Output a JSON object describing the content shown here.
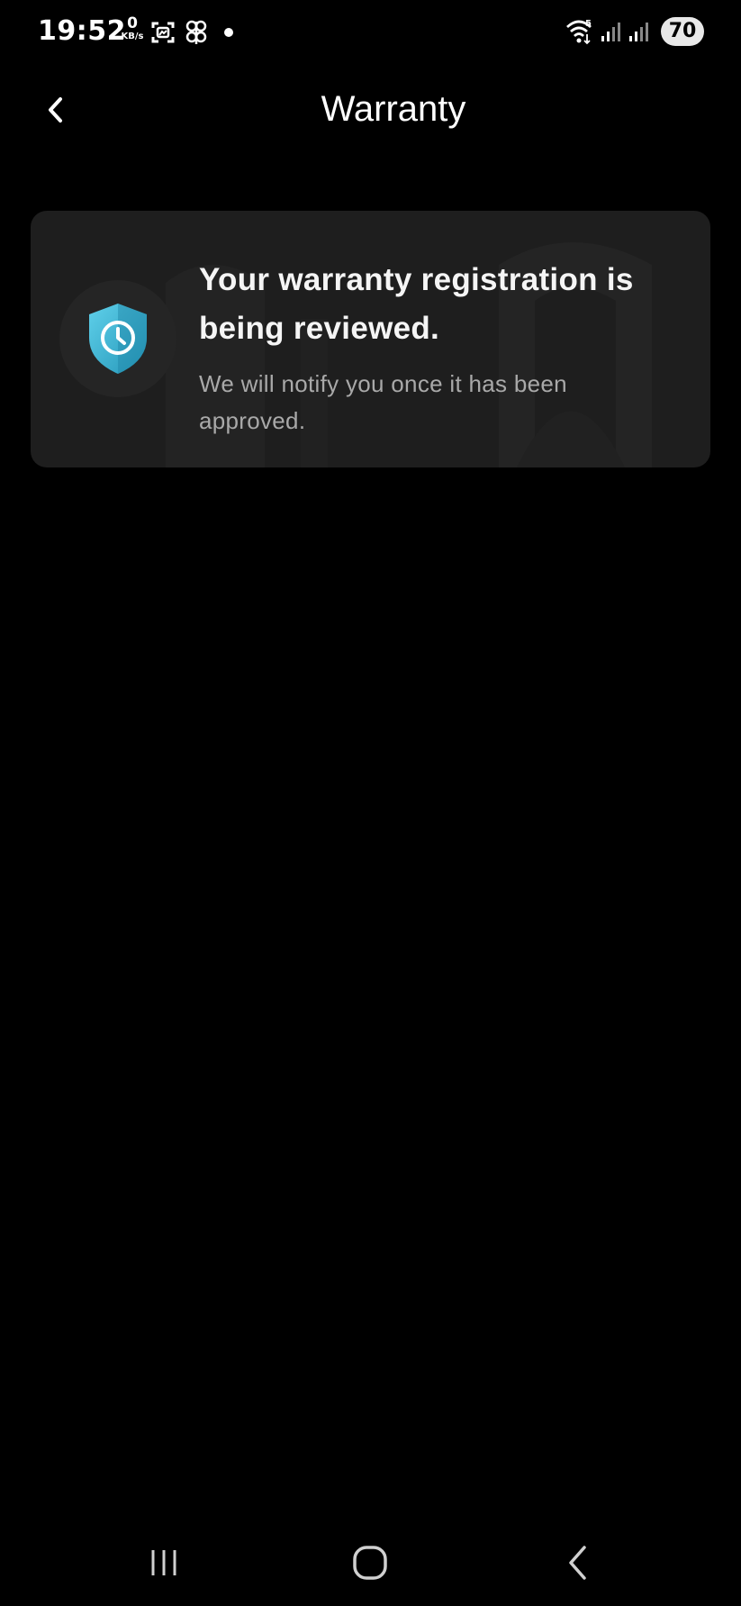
{
  "status_bar": {
    "time": "19:52",
    "data_rate_value": "0",
    "data_rate_unit": "KB/s",
    "battery": "70",
    "icons": [
      "screenshot-icon",
      "butterfly-icon",
      "notification-dot",
      "wifi-icon",
      "signal-icon",
      "signal-icon"
    ]
  },
  "header": {
    "title": "Warranty",
    "back_icon": "chevron-left-icon"
  },
  "card": {
    "icon": "shield-clock-icon",
    "title": "Your warranty registration is being reviewed.",
    "subtitle": "We will notify you once it has been approved.",
    "accent_color": "#3fb6d4"
  },
  "nav_bar": {
    "icons": [
      "recents-icon",
      "home-icon",
      "back-icon"
    ]
  }
}
